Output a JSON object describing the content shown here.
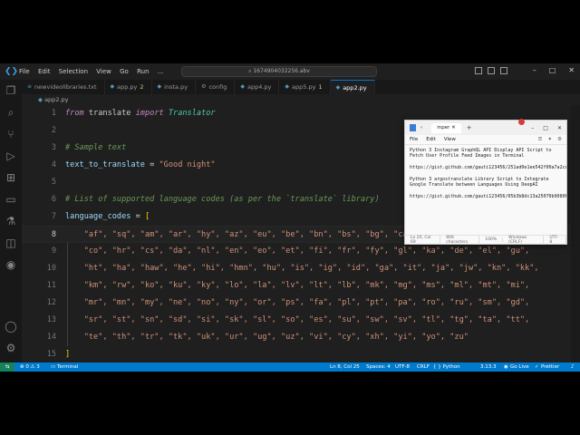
{
  "titlebar": {
    "menu": [
      "File",
      "Edit",
      "Selection",
      "View",
      "Go",
      "Run",
      "..."
    ],
    "search": "1674904032256.abv",
    "window_controls": [
      "–",
      "□",
      "✕"
    ]
  },
  "tabs": [
    {
      "label": "newvideolibraries.txt",
      "active": false,
      "modified": ""
    },
    {
      "label": "app.py",
      "active": false,
      "modified": "2"
    },
    {
      "label": "insta.py",
      "active": false,
      "modified": ""
    },
    {
      "label": "config",
      "active": false,
      "modified": ""
    },
    {
      "label": "app4.py",
      "active": false,
      "modified": ""
    },
    {
      "label": "app5.py",
      "active": false,
      "modified": "1"
    },
    {
      "label": "app2.py",
      "active": true,
      "modified": ""
    }
  ],
  "breadcrumb": "app2.py",
  "editor": {
    "line_numbers": [
      "1",
      "2",
      "3",
      "4",
      "5",
      "6",
      "7",
      "8",
      "9",
      "10",
      "11",
      "12",
      "13",
      "14",
      "15"
    ],
    "current_line": "8",
    "l1": {
      "kw1": "from",
      "mod": " translate ",
      "kw2": "import",
      "cls": " Translator"
    },
    "l3": "# Sample text",
    "l4": {
      "var": "text_to_translate",
      "op": " = ",
      "str": "\"Good night\""
    },
    "l6": "# List of supported language codes (as per the `translate` library)",
    "l7": {
      "var": "language_codes",
      "op": " = ",
      "br": "["
    },
    "l8": "    \"af\", \"sq\", \"am\", \"ar\", \"hy\", \"az\", \"eu\", \"be\", \"bn\", \"bs\", \"bg\", \"ca\", \"ceb\", \"ny\", \"zh\",",
    "l9": "    \"co\", \"hr\", \"cs\", \"da\", \"nl\", \"en\", \"eo\", \"et\", \"fi\", \"fr\", \"fy\", \"gl\", \"ka\", \"de\", \"el\", \"gu\",",
    "l10": "    \"ht\", \"ha\", \"haw\", \"he\", \"hi\", \"hmn\", \"hu\", \"is\", \"ig\", \"id\", \"ga\", \"it\", \"ja\", \"jw\", \"kn\", \"kk\",",
    "l11": "    \"km\", \"rw\", \"ko\", \"ku\", \"ky\", \"lo\", \"la\", \"lv\", \"lt\", \"lb\", \"mk\", \"mg\", \"ms\", \"ml\", \"mt\", \"mi\",",
    "l12": "    \"mr\", \"mn\", \"my\", \"ne\", \"no\", \"ny\", \"or\", \"ps\", \"fa\", \"pl\", \"pt\", \"pa\", \"ro\", \"ru\", \"sm\", \"gd\",",
    "l13": "    \"sr\", \"st\", \"sn\", \"sd\", \"si\", \"sk\", \"sl\", \"so\", \"es\", \"su\", \"sw\", \"sv\", \"tl\", \"tg\", \"ta\", \"tt\",",
    "l14": "    \"te\", \"th\", \"tr\", \"tk\", \"uk\", \"ur\", \"ug\", \"uz\", \"vi\", \"cy\", \"xh\", \"yi\", \"yo\", \"zu\"",
    "l15": "]"
  },
  "statusbar": {
    "problems": "⊗ 0 ⚠ 3",
    "terminal": "Terminal",
    "position": "Ln 8, Col 25",
    "spaces": "Spaces: 4",
    "encoding": "UTF-8",
    "eol": "CRLF",
    "language": "{ } Python",
    "python_version": "3.13.3",
    "go_live": "Go Live",
    "prettier": "Prettier"
  },
  "notepad": {
    "tab_title": "inper",
    "menu": [
      "File",
      "Edit",
      "View"
    ],
    "paragraphs": [
      "Python 3 Instagram GraphQL API Display API Script to Fetch User Profile Feed Images in Terminal",
      "https://gist.github.com/gauti123456/251ad0e1ee542f00a7a2cd07e5cd13c0",
      "Python 3 argostranslate Library Script to Integrate Google Translate between Languages Using DeepAI",
      "https://gist.github.com/gauti123456/05b3b8dc13a25070b90800bae1328707e"
    ],
    "status": [
      "Ln 20, Col 69",
      "806 characters",
      "100%",
      "Windows (CRLF)",
      "UTF-8"
    ]
  }
}
